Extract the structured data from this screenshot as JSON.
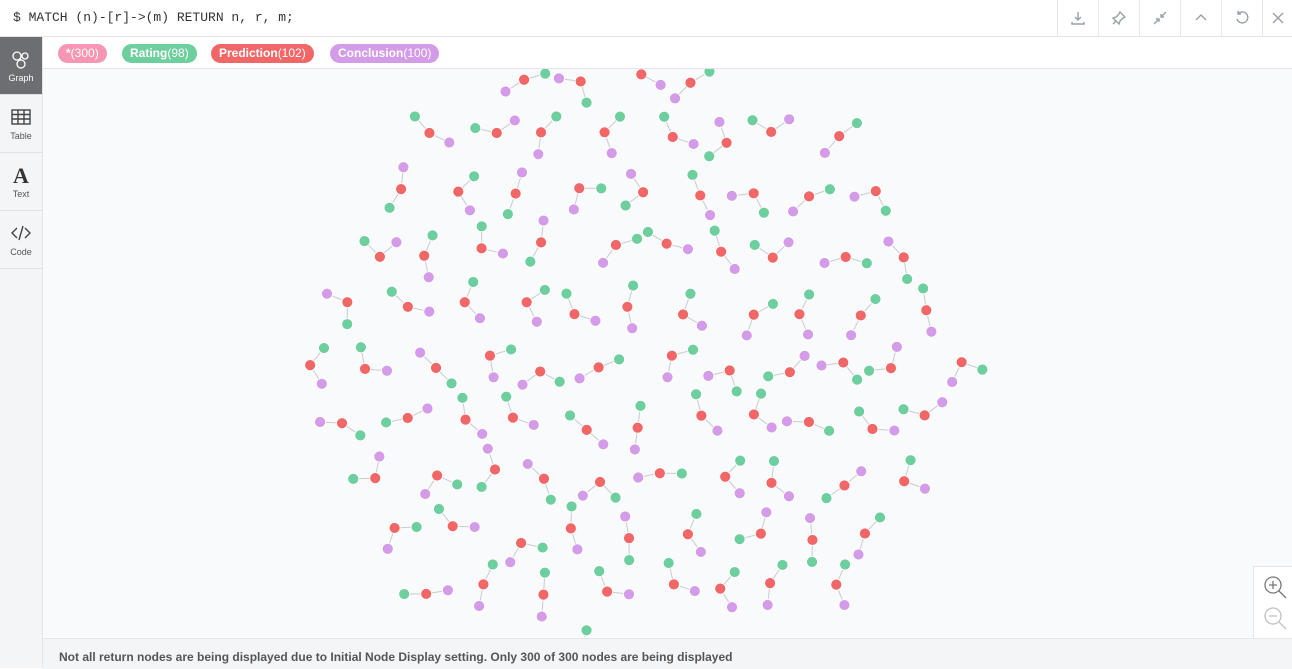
{
  "query": "$ MATCH (n)-[r]->(m) RETURN n, r, m;",
  "toolbar": [
    {
      "name": "download-icon"
    },
    {
      "name": "pin-icon"
    },
    {
      "name": "collapse-icon"
    },
    {
      "name": "chevron-up-icon"
    },
    {
      "name": "refresh-icon"
    },
    {
      "name": "close-icon"
    }
  ],
  "sidebar": [
    {
      "label": "Graph",
      "icon": "graph-icon",
      "active": true
    },
    {
      "label": "Table",
      "icon": "table-icon",
      "active": false
    },
    {
      "label": "Text",
      "icon": "text-icon",
      "active": false
    },
    {
      "label": "Code",
      "icon": "code-icon",
      "active": false
    }
  ],
  "legend": [
    {
      "name": "*",
      "count": "(300)",
      "color": "#f796b4"
    },
    {
      "name": "Rating",
      "count": "(98)",
      "color": "#6dce9e"
    },
    {
      "name": "Prediction",
      "count": "(102)",
      "color": "#f16667"
    },
    {
      "name": "Conclusion",
      "count": "(100)",
      "color": "#d39be8"
    }
  ],
  "colors": {
    "rating": "#6dce9e",
    "prediction": "#f16667",
    "conclusion": "#d39be8"
  },
  "footer": "Not all return nodes are being displayed due to Initial Node Display setting. Only 300 of 300 nodes are being displayed"
}
